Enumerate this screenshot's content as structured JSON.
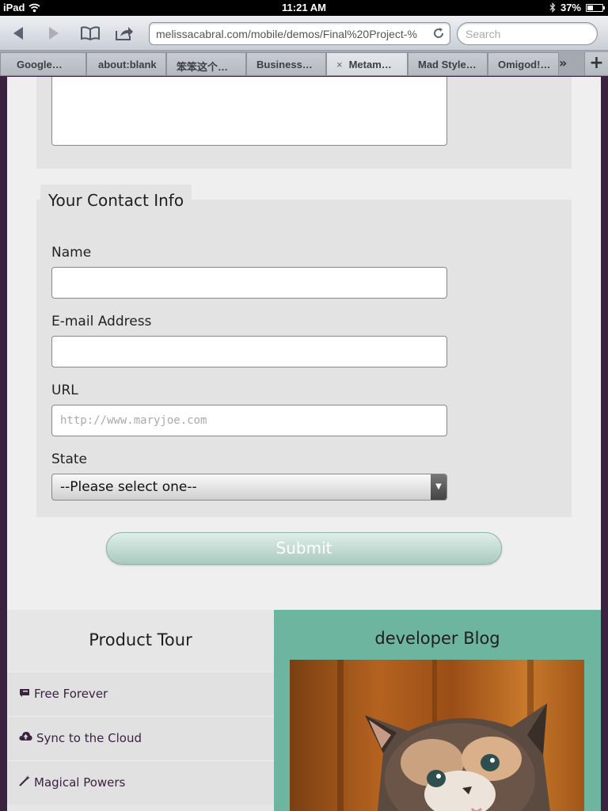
{
  "status": {
    "device": "iPad",
    "time": "11:21 AM",
    "battery": "37%",
    "battery_level": 0.37
  },
  "toolbar": {
    "url": "melissacabral.com/mobile/demos/Final%20Project-%",
    "search_placeholder": "Search"
  },
  "tabs": [
    {
      "label": "Google…"
    },
    {
      "label": "about:blank"
    },
    {
      "label": "笨笨这个…"
    },
    {
      "label": "Business…"
    },
    {
      "label": "Metam…",
      "close": "×"
    },
    {
      "label": "Mad Style…"
    },
    {
      "label": "Omigod!…"
    }
  ],
  "tabs_more": "»",
  "tabs_add": "+",
  "form": {
    "legend": "Your Contact Info",
    "name_label": "Name",
    "email_label": "E-mail Address",
    "url_label": "URL",
    "url_placeholder": "http://www.maryjoe.com",
    "state_label": "State",
    "state_selected": "--Please select one--",
    "submit_label": "Submit"
  },
  "footer": {
    "tour_title": "Product Tour",
    "tour_items": [
      {
        "label": "Free Forever",
        "icon": "ticket-icon"
      },
      {
        "label": "Sync to the Cloud",
        "icon": "cloud-upload-icon"
      },
      {
        "label": "Magical Powers",
        "icon": "magic-wand-icon"
      }
    ],
    "blog_title": "developer Blog"
  },
  "colors": {
    "page_border": "#3a2240",
    "fieldset_bg": "#e3e3e3",
    "blog_bg": "#6db59f",
    "link_color": "#3a2240"
  }
}
